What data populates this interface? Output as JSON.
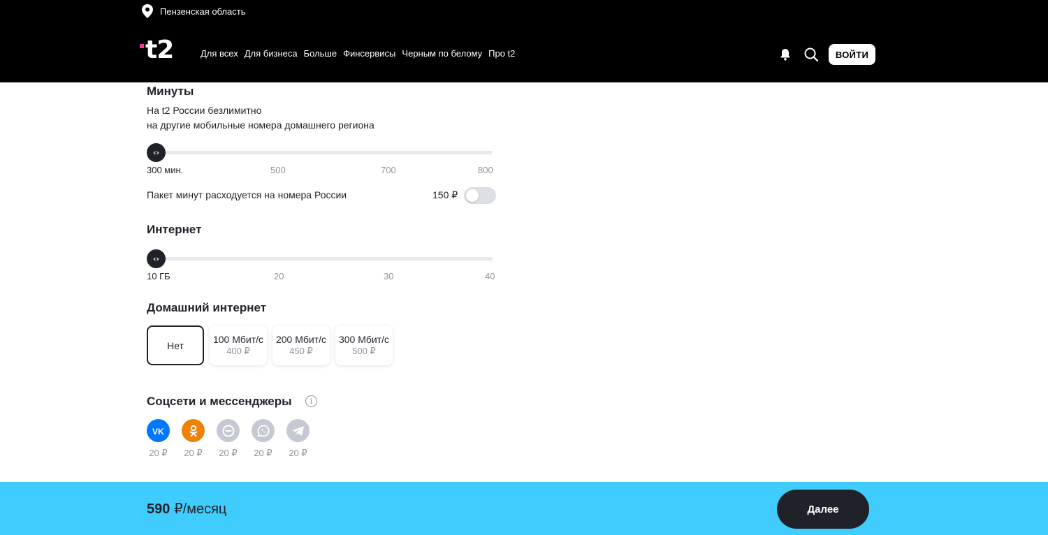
{
  "header": {
    "region": "Пензенская область",
    "logo_text": "t2",
    "nav": [
      "Для всех",
      "Для бизнеса",
      "Больше",
      "Финсервисы",
      "Черным по белому",
      "Про t2"
    ],
    "login_label": "ВОЙТИ"
  },
  "minutes": {
    "title": "Минуты",
    "desc_line1": "На t2 России безлимитно",
    "desc_line2": "на другие мобильные номера домашнего региона",
    "ticks": [
      "300 мин.",
      "500",
      "700",
      "800"
    ],
    "selected_index": 0,
    "toggle_label": "Пакет минут расходуется на номера России",
    "toggle_price": "150 ₽",
    "toggle_on": false
  },
  "internet": {
    "title": "Интернет",
    "ticks": [
      "10 ГБ",
      "20",
      "30",
      "40"
    ],
    "selected_index": 0
  },
  "home_internet": {
    "title": "Домашний интернет",
    "options": [
      {
        "label": "Нет",
        "price": "",
        "selected": true
      },
      {
        "label": "100 Мбит/с",
        "price": "400 ₽",
        "selected": false
      },
      {
        "label": "200 Мбит/с",
        "price": "450 ₽",
        "selected": false
      },
      {
        "label": "300 Мбит/с",
        "price": "500 ₽",
        "selected": false
      }
    ]
  },
  "socials": {
    "title": "Соцсети и мессенджеры",
    "items": [
      {
        "icon": "vk-icon",
        "price": "20 ₽",
        "active": true,
        "color": "#0077ff"
      },
      {
        "icon": "ok-icon",
        "price": "20 ₽",
        "active": true,
        "color": "#ee8208"
      },
      {
        "icon": "chat-icon",
        "price": "20 ₽",
        "active": false,
        "color": "#b4b9c5"
      },
      {
        "icon": "whatsapp-icon",
        "price": "20 ₽",
        "active": false,
        "color": "#b4b9c5"
      },
      {
        "icon": "telegram-icon",
        "price": "20 ₽",
        "active": false,
        "color": "#b4b9c5"
      }
    ]
  },
  "footer": {
    "price": "590",
    "price_suffix": "₽/месяц",
    "next_label": "Далее"
  },
  "colors": {
    "accent_pink": "#ff3495",
    "footer_bg": "#40ccfd",
    "dark": "#1f2229"
  }
}
